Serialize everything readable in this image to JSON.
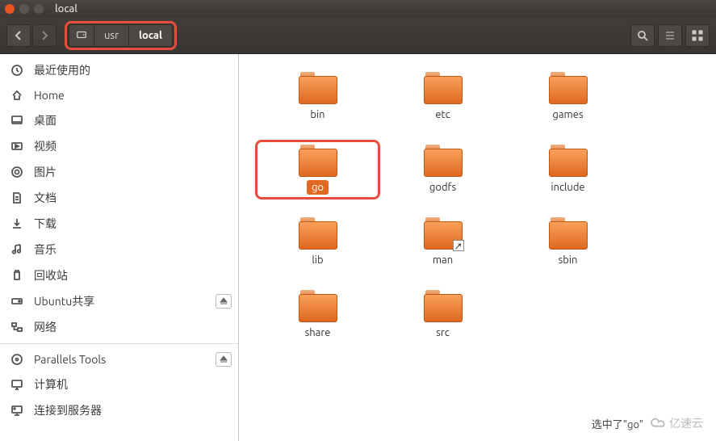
{
  "window": {
    "title": "local"
  },
  "breadcrumb": {
    "disk_icon": "disk",
    "items": [
      "usr",
      "local"
    ]
  },
  "toolbar": {
    "back": "back",
    "forward": "forward",
    "search": "search",
    "list_view": "list",
    "grid_view": "grid"
  },
  "sidebar": {
    "items": [
      {
        "icon": "recent",
        "label": "最近使用的"
      },
      {
        "icon": "home",
        "label": "Home"
      },
      {
        "icon": "desktop",
        "label": "桌面"
      },
      {
        "icon": "videos",
        "label": "视频"
      },
      {
        "icon": "pictures",
        "label": "图片"
      },
      {
        "icon": "documents",
        "label": "文档"
      },
      {
        "icon": "downloads",
        "label": "下载"
      },
      {
        "icon": "music",
        "label": "音乐"
      },
      {
        "icon": "trash",
        "label": "回收站"
      },
      {
        "icon": "drive",
        "label": "Ubuntu共享",
        "eject": true
      },
      {
        "icon": "network",
        "label": "网络"
      },
      {
        "sep": true
      },
      {
        "icon": "cd",
        "label": "Parallels Tools",
        "eject": true
      },
      {
        "icon": "computer",
        "label": "计算机"
      },
      {
        "icon": "server",
        "label": "连接到服务器"
      }
    ]
  },
  "folders": [
    {
      "name": "bin",
      "selected": false,
      "link": false
    },
    {
      "name": "etc",
      "selected": false,
      "link": false
    },
    {
      "name": "games",
      "selected": false,
      "link": false
    },
    {
      "name": "go",
      "selected": true,
      "link": false
    },
    {
      "name": "godfs",
      "selected": false,
      "link": false
    },
    {
      "name": "include",
      "selected": false,
      "link": false
    },
    {
      "name": "lib",
      "selected": false,
      "link": false
    },
    {
      "name": "man",
      "selected": false,
      "link": true
    },
    {
      "name": "sbin",
      "selected": false,
      "link": false
    },
    {
      "name": "share",
      "selected": false,
      "link": false
    },
    {
      "name": "src",
      "selected": false,
      "link": false
    }
  ],
  "status": {
    "text": "选中了\"go\""
  },
  "watermark": {
    "text": "亿速云"
  }
}
